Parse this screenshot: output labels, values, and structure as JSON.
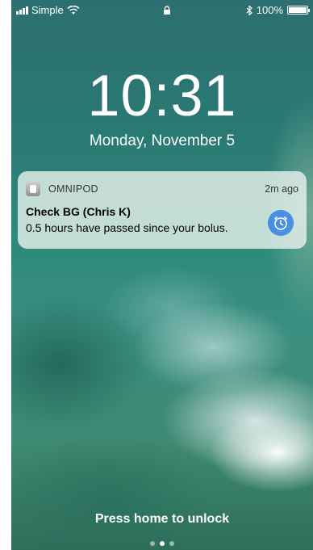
{
  "status_bar": {
    "carrier": "Simple",
    "battery": "100%"
  },
  "lock_screen": {
    "time": "10:31",
    "date": "Monday, November 5",
    "unlock_hint": "Press home to unlock"
  },
  "notification": {
    "app_name": "OMNIPOD",
    "time_ago": "2m ago",
    "title": "Check BG (Chris K)",
    "body": "0.5 hours have passed since your bolus.",
    "icon": "alarm-clock-icon",
    "accent": "#4a90e2"
  },
  "page_dots": {
    "count": 3,
    "active_index": 1
  }
}
